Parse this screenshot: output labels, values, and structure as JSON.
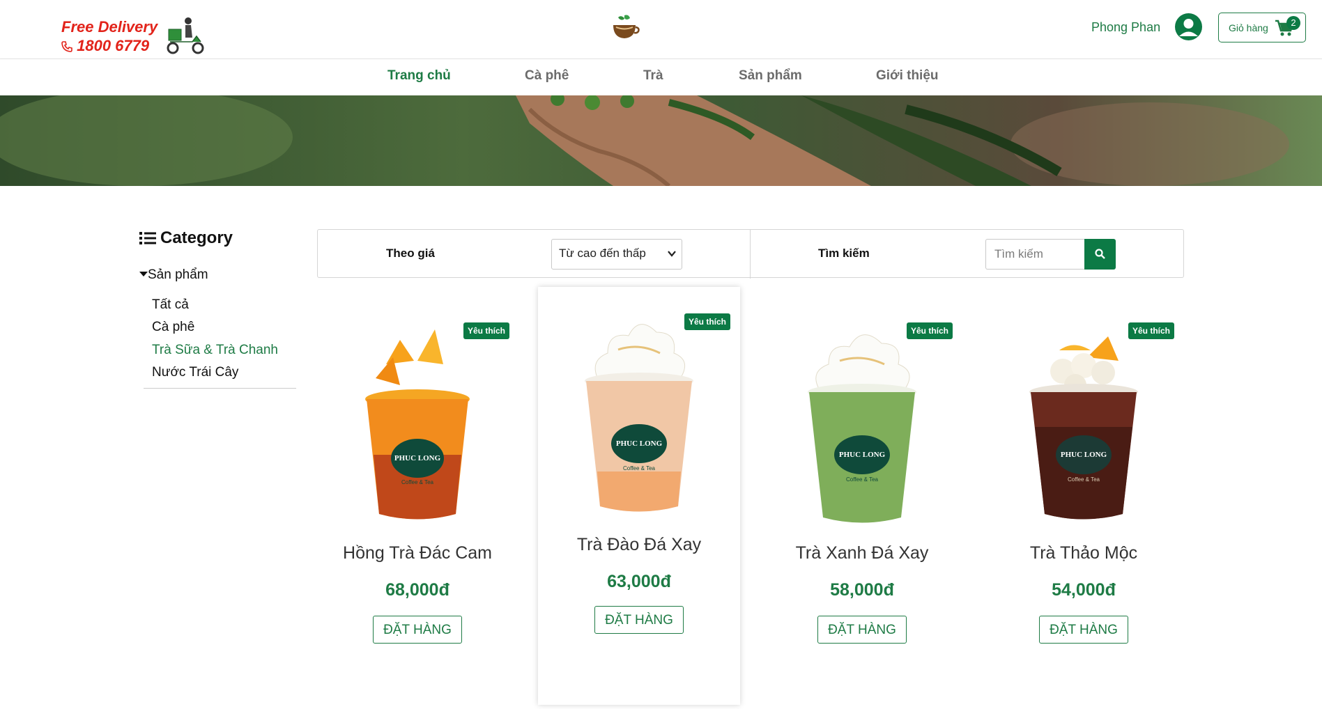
{
  "header": {
    "delivery_line1": "Free Delivery",
    "delivery_line2": "1800 6779",
    "user_name": "Phong Phan",
    "cart_label": "Giỏ hàng",
    "cart_count": "2"
  },
  "nav": {
    "items": [
      "Trang chủ",
      "Cà phê",
      "Trà",
      "Sản phẩm",
      "Giới thiệu"
    ],
    "active": "Trang chủ"
  },
  "sidebar": {
    "title": "Category",
    "parent": "Sản phẩm",
    "items": [
      "Tất cả",
      "Cà phê",
      "Trà Sữa & Trà Chanh",
      "Nước Trái Cây"
    ],
    "active": "Trà Sữa & Trà Chanh"
  },
  "filters": {
    "price_label": "Theo giá",
    "price_selected": "Từ cao đến thấp",
    "search_label": "Tìm kiếm",
    "search_placeholder": "Tìm kiếm"
  },
  "products": [
    {
      "name": "Hồng Trà Đác Cam",
      "price": "68,000đ",
      "badge": "Yêu thích",
      "order": "ĐẶT HÀNG"
    },
    {
      "name": "Trà Đào Đá Xay",
      "price": "63,000đ",
      "badge": "Yêu thích",
      "order": "ĐẶT HÀNG"
    },
    {
      "name": "Trà Xanh Đá Xay",
      "price": "58,000đ",
      "badge": "Yêu thích",
      "order": "ĐẶT HÀNG"
    },
    {
      "name": "Trà Thảo Mộc",
      "price": "54,000đ",
      "badge": "Yêu thích",
      "order": "ĐẶT HÀNG"
    }
  ],
  "cup_logo_text": {
    "brand": "PHUC LONG",
    "sub": "Coffee & Tea"
  },
  "colors": {
    "brand_green": "#1e7b45",
    "accent_red": "#e2231a"
  },
  "icons": [
    "scooter-icon",
    "phone-icon",
    "coffee-logo-icon",
    "user-avatar-icon",
    "cart-icon",
    "list-icon",
    "caret-down-icon",
    "chevron-down-icon",
    "search-icon"
  ]
}
